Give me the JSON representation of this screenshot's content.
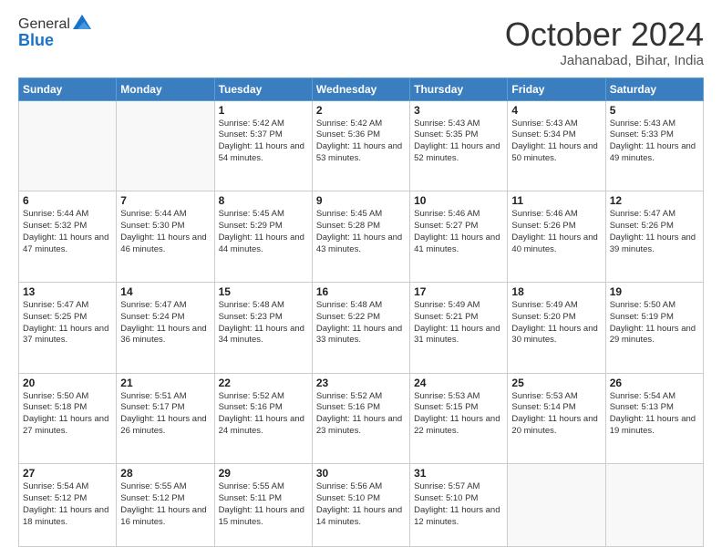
{
  "header": {
    "logo_general": "General",
    "logo_blue": "Blue",
    "month": "October 2024",
    "location": "Jahanabad, Bihar, India"
  },
  "days_of_week": [
    "Sunday",
    "Monday",
    "Tuesday",
    "Wednesday",
    "Thursday",
    "Friday",
    "Saturday"
  ],
  "weeks": [
    [
      {
        "day": "",
        "content": ""
      },
      {
        "day": "",
        "content": ""
      },
      {
        "day": "1",
        "content": "Sunrise: 5:42 AM\nSunset: 5:37 PM\nDaylight: 11 hours and 54 minutes."
      },
      {
        "day": "2",
        "content": "Sunrise: 5:42 AM\nSunset: 5:36 PM\nDaylight: 11 hours and 53 minutes."
      },
      {
        "day": "3",
        "content": "Sunrise: 5:43 AM\nSunset: 5:35 PM\nDaylight: 11 hours and 52 minutes."
      },
      {
        "day": "4",
        "content": "Sunrise: 5:43 AM\nSunset: 5:34 PM\nDaylight: 11 hours and 50 minutes."
      },
      {
        "day": "5",
        "content": "Sunrise: 5:43 AM\nSunset: 5:33 PM\nDaylight: 11 hours and 49 minutes."
      }
    ],
    [
      {
        "day": "6",
        "content": "Sunrise: 5:44 AM\nSunset: 5:32 PM\nDaylight: 11 hours and 47 minutes."
      },
      {
        "day": "7",
        "content": "Sunrise: 5:44 AM\nSunset: 5:30 PM\nDaylight: 11 hours and 46 minutes."
      },
      {
        "day": "8",
        "content": "Sunrise: 5:45 AM\nSunset: 5:29 PM\nDaylight: 11 hours and 44 minutes."
      },
      {
        "day": "9",
        "content": "Sunrise: 5:45 AM\nSunset: 5:28 PM\nDaylight: 11 hours and 43 minutes."
      },
      {
        "day": "10",
        "content": "Sunrise: 5:46 AM\nSunset: 5:27 PM\nDaylight: 11 hours and 41 minutes."
      },
      {
        "day": "11",
        "content": "Sunrise: 5:46 AM\nSunset: 5:26 PM\nDaylight: 11 hours and 40 minutes."
      },
      {
        "day": "12",
        "content": "Sunrise: 5:47 AM\nSunset: 5:26 PM\nDaylight: 11 hours and 39 minutes."
      }
    ],
    [
      {
        "day": "13",
        "content": "Sunrise: 5:47 AM\nSunset: 5:25 PM\nDaylight: 11 hours and 37 minutes."
      },
      {
        "day": "14",
        "content": "Sunrise: 5:47 AM\nSunset: 5:24 PM\nDaylight: 11 hours and 36 minutes."
      },
      {
        "day": "15",
        "content": "Sunrise: 5:48 AM\nSunset: 5:23 PM\nDaylight: 11 hours and 34 minutes."
      },
      {
        "day": "16",
        "content": "Sunrise: 5:48 AM\nSunset: 5:22 PM\nDaylight: 11 hours and 33 minutes."
      },
      {
        "day": "17",
        "content": "Sunrise: 5:49 AM\nSunset: 5:21 PM\nDaylight: 11 hours and 31 minutes."
      },
      {
        "day": "18",
        "content": "Sunrise: 5:49 AM\nSunset: 5:20 PM\nDaylight: 11 hours and 30 minutes."
      },
      {
        "day": "19",
        "content": "Sunrise: 5:50 AM\nSunset: 5:19 PM\nDaylight: 11 hours and 29 minutes."
      }
    ],
    [
      {
        "day": "20",
        "content": "Sunrise: 5:50 AM\nSunset: 5:18 PM\nDaylight: 11 hours and 27 minutes."
      },
      {
        "day": "21",
        "content": "Sunrise: 5:51 AM\nSunset: 5:17 PM\nDaylight: 11 hours and 26 minutes."
      },
      {
        "day": "22",
        "content": "Sunrise: 5:52 AM\nSunset: 5:16 PM\nDaylight: 11 hours and 24 minutes."
      },
      {
        "day": "23",
        "content": "Sunrise: 5:52 AM\nSunset: 5:16 PM\nDaylight: 11 hours and 23 minutes."
      },
      {
        "day": "24",
        "content": "Sunrise: 5:53 AM\nSunset: 5:15 PM\nDaylight: 11 hours and 22 minutes."
      },
      {
        "day": "25",
        "content": "Sunrise: 5:53 AM\nSunset: 5:14 PM\nDaylight: 11 hours and 20 minutes."
      },
      {
        "day": "26",
        "content": "Sunrise: 5:54 AM\nSunset: 5:13 PM\nDaylight: 11 hours and 19 minutes."
      }
    ],
    [
      {
        "day": "27",
        "content": "Sunrise: 5:54 AM\nSunset: 5:12 PM\nDaylight: 11 hours and 18 minutes."
      },
      {
        "day": "28",
        "content": "Sunrise: 5:55 AM\nSunset: 5:12 PM\nDaylight: 11 hours and 16 minutes."
      },
      {
        "day": "29",
        "content": "Sunrise: 5:55 AM\nSunset: 5:11 PM\nDaylight: 11 hours and 15 minutes."
      },
      {
        "day": "30",
        "content": "Sunrise: 5:56 AM\nSunset: 5:10 PM\nDaylight: 11 hours and 14 minutes."
      },
      {
        "day": "31",
        "content": "Sunrise: 5:57 AM\nSunset: 5:10 PM\nDaylight: 11 hours and 12 minutes."
      },
      {
        "day": "",
        "content": ""
      },
      {
        "day": "",
        "content": ""
      }
    ]
  ]
}
